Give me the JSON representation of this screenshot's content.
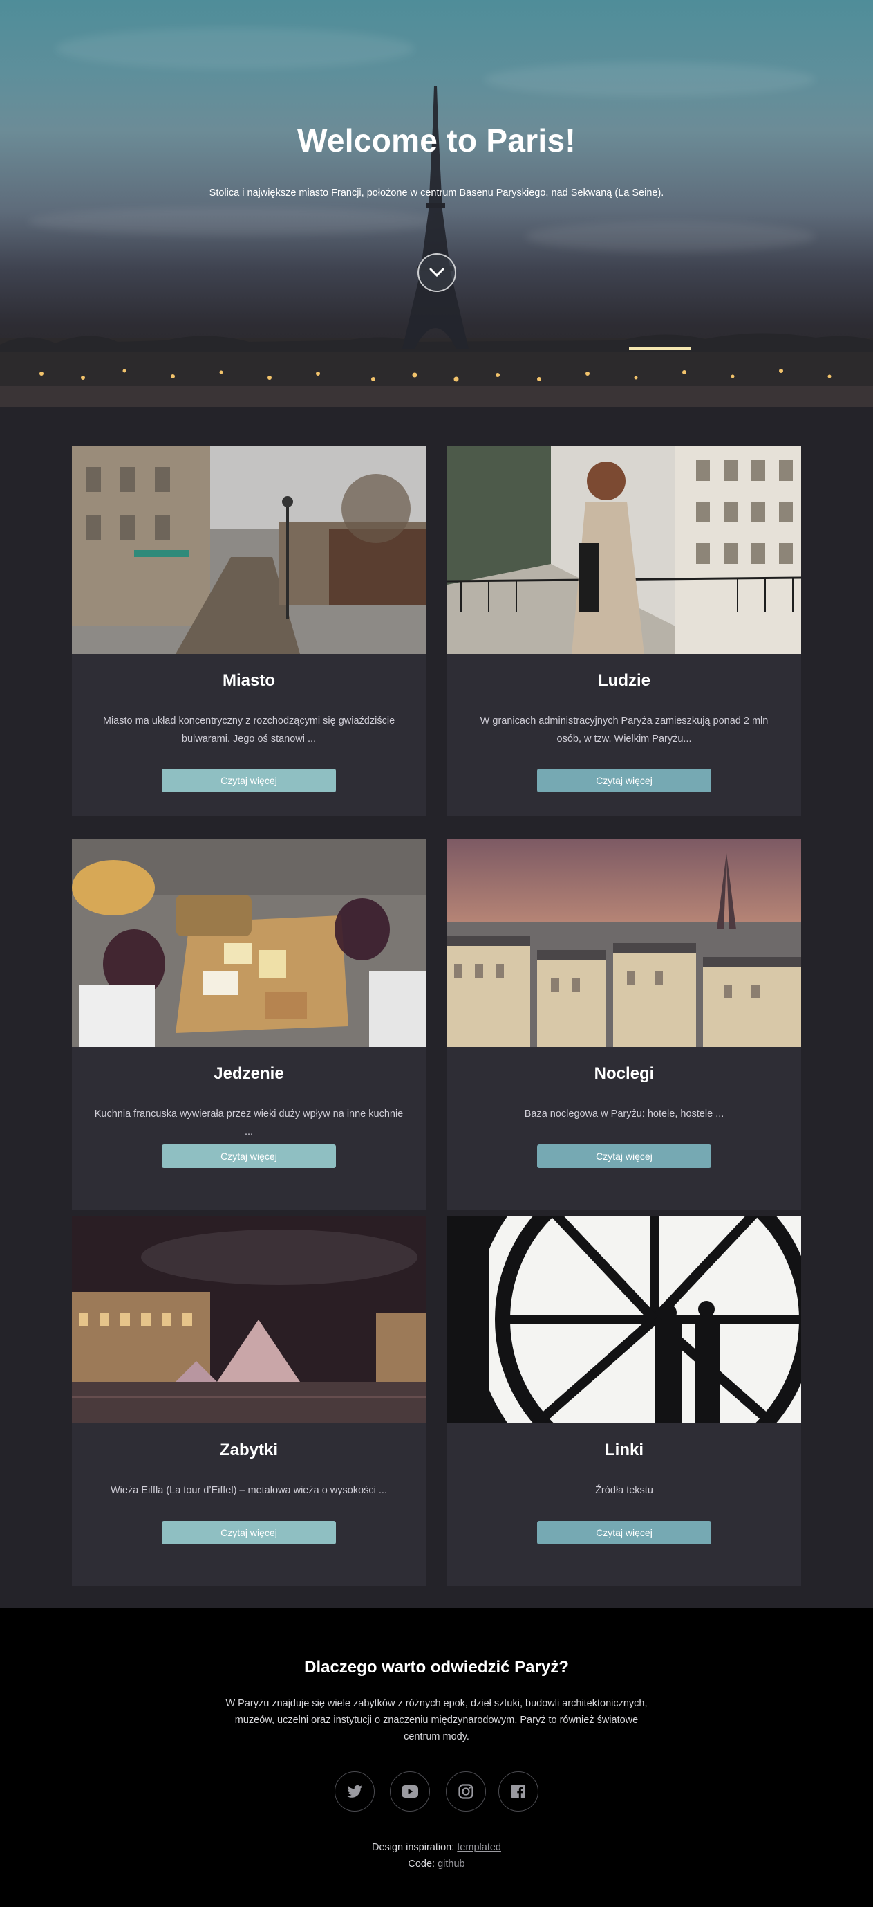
{
  "hero": {
    "title": "Welcome to Paris!",
    "subtitle": "Stolica i największe miasto Francji, położone w centrum Basenu Paryskiego, nad Sekwaną (La Seine).",
    "scroll_icon": "chevron-down-icon"
  },
  "cards": [
    {
      "title": "Miasto",
      "text": "Miasto ma układ koncentryczny z rozchodzącymi się gwiaździście bulwarami. Jego oś stanowi ...",
      "button": "Czytaj więcej"
    },
    {
      "title": "Ludzie",
      "text": "W granicach administracyjnych Paryża zamieszkują ponad 2 mln osób, w tzw. Wielkim Paryżu...",
      "button": "Czytaj więcej"
    },
    {
      "title": "Jedzenie",
      "text": "Kuchnia francuska wywierała przez wieki duży wpływ na inne kuchnie ...",
      "button": "Czytaj więcej"
    },
    {
      "title": "Noclegi",
      "text": "Baza noclegowa w Paryżu: hotele, hostele ...",
      "button": "Czytaj więcej"
    },
    {
      "title": "Zabytki",
      "text": "Wieża Eiffla (La tour d’Eiffel) – metalowa wieża o wysokości ...",
      "button": "Czytaj więcej"
    },
    {
      "title": "Linki",
      "text": "Źródła tekstu",
      "button": "Czytaj więcej"
    }
  ],
  "footer": {
    "title": "Dlaczego warto odwiedzić Paryż?",
    "text": "W Paryżu znajduje się wiele zabytków z różnych epok, dzieł sztuki, budowli architektonicznych, muzeów, uczelni oraz instytucji o znaczeniu międzynarodowym. Paryż to również światowe centrum mody.",
    "social": [
      "twitter-icon",
      "youtube-icon",
      "instagram-icon",
      "facebook-icon"
    ],
    "design_label": "Design inspiration:",
    "design_link": "templated",
    "code_label": "Code:",
    "code_link": "github"
  },
  "colors": {
    "page_bg": "#242329",
    "card_bg": "#2e2d35",
    "button_light": "#8fbfc2",
    "button_dark": "#76a9b3",
    "footer_bg": "#000000"
  }
}
